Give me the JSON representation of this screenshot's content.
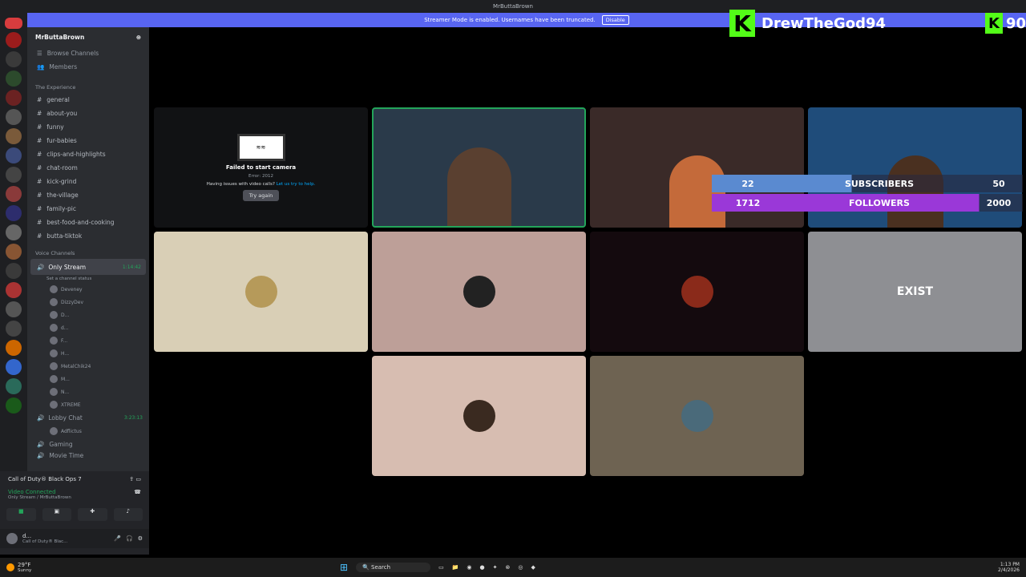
{
  "window": {
    "title": "MrButtaBrown"
  },
  "banner": {
    "text": "Streamer Mode is enabled. Usernames have been truncated.",
    "button": "Disable"
  },
  "overlay": {
    "username": "DrewTheGod94",
    "count": "90",
    "subs_current": "22",
    "subs_label": "SUBSCRIBERS",
    "subs_goal": "50",
    "followers_current": "1712",
    "followers_label": "FOLLOWERS",
    "followers_goal": "2000"
  },
  "sidebar": {
    "server_name": "MrButtaBrown",
    "browse": "Browse Channels",
    "members": "Members",
    "category": "The Experience",
    "channels": [
      "general",
      "about-you",
      "funny",
      "fur-babies",
      "clips-and-highlights",
      "chat-room",
      "kick-grind",
      "the-village",
      "family-pic",
      "best-food-and-cooking",
      "butta-tiktok"
    ],
    "voice_category": "Voice Channels",
    "voice_active": {
      "name": "Only Stream",
      "time": "1:14:42",
      "status": "Set a channel status"
    },
    "voice_users": [
      "Deveney",
      "DizzyDev",
      "D...",
      "d...",
      "F...",
      "H...",
      "MetalChik24",
      "M...",
      "N...",
      "XTREME"
    ],
    "lobby": {
      "name": "Lobby Chat",
      "time": "3:23:13",
      "user": "Adflictus"
    },
    "gaming": "Gaming",
    "movie": "Movie Time"
  },
  "panel": {
    "game": "Call of Duty® Black Ops 7",
    "connected": "Video Connected",
    "channel_path": "Only Stream / MrButtaBrown",
    "user": "d...",
    "user_status": "Call of Duty® Blac..."
  },
  "tiles": {
    "camera_error": "Failed to start camera",
    "error_code": "Error: 2012",
    "help_text": "Having issues with video calls?",
    "help_link": "Let us try to help.",
    "try_again": "Try again",
    "exist_label": "EXIST"
  },
  "taskbar": {
    "search": "Search",
    "weather": "29°F",
    "weather_desc": "Sunny",
    "time": "1:13 PM",
    "date": "2/4/2026"
  }
}
